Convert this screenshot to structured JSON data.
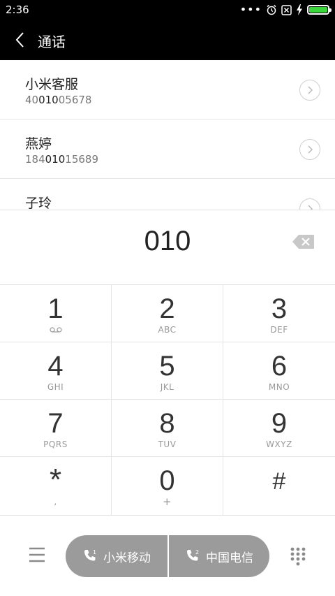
{
  "status_bar": {
    "time": "2:36",
    "overflow": "•••",
    "icons": [
      "alarm-icon",
      "no-sim-icon",
      "charging-icon",
      "battery-icon"
    ],
    "battery_color": "#3bd63b"
  },
  "title_bar": {
    "title": "通话",
    "back_icon": "back-arrow-icon"
  },
  "results": [
    {
      "name": "小米客服",
      "number_pre": "40",
      "number_match": "010",
      "number_post": "05678"
    },
    {
      "name": "燕婷",
      "number_pre": "184",
      "number_match": "010",
      "number_post": "15689"
    },
    {
      "name": "子玲",
      "number_pre": "",
      "number_match": "",
      "number_post": ""
    }
  ],
  "input": {
    "digits": "010"
  },
  "keypad": [
    {
      "num": "1",
      "sub": ""
    },
    {
      "num": "2",
      "sub": "ABC"
    },
    {
      "num": "3",
      "sub": "DEF"
    },
    {
      "num": "4",
      "sub": "GHI"
    },
    {
      "num": "5",
      "sub": "JKL"
    },
    {
      "num": "6",
      "sub": "MNO"
    },
    {
      "num": "7",
      "sub": "PQRS"
    },
    {
      "num": "8",
      "sub": "TUV"
    },
    {
      "num": "9",
      "sub": "WXYZ"
    },
    {
      "num": "*",
      "sub": ","
    },
    {
      "num": "0",
      "sub": "+"
    },
    {
      "num": "#",
      "sub": ""
    }
  ],
  "bottom_bar": {
    "sim1_label": "小米移动",
    "sim1_badge": "1",
    "sim2_label": "中国电信",
    "sim2_badge": "2",
    "call_button_color": "#9b9b9b"
  }
}
